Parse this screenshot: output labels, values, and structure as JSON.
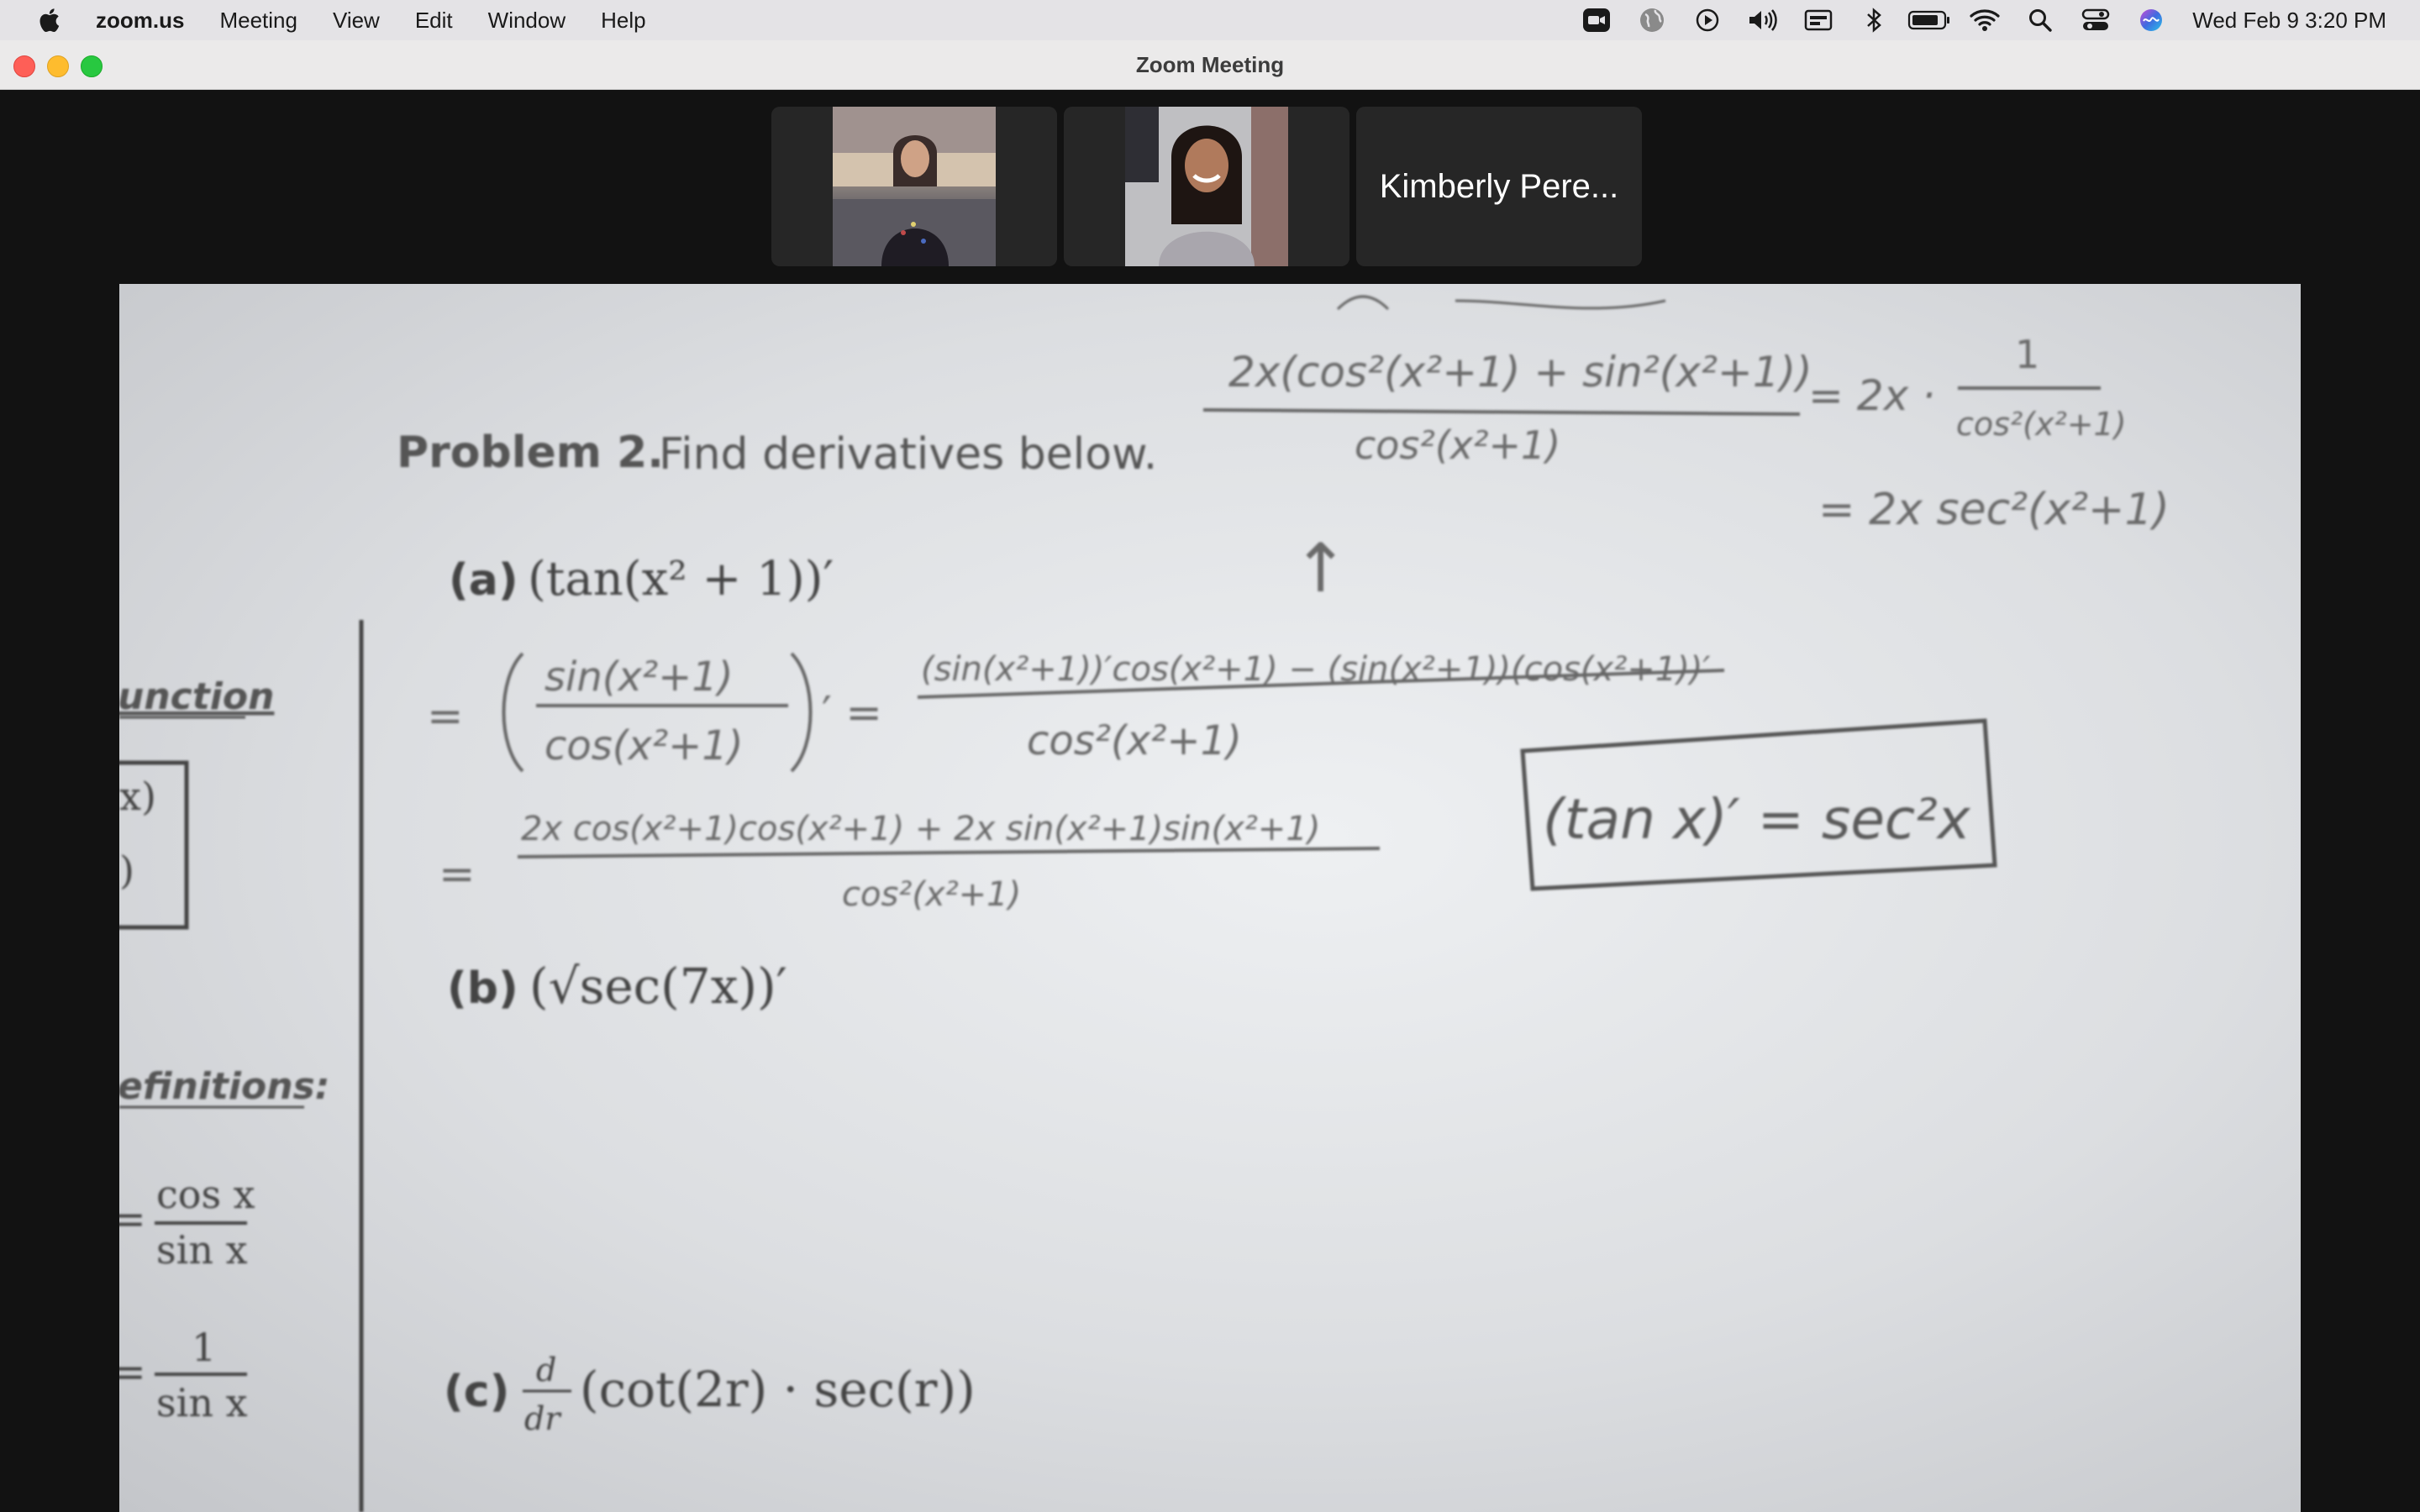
{
  "menubar": {
    "app_name": "zoom.us",
    "items": [
      "Meeting",
      "View",
      "Edit",
      "Window",
      "Help"
    ],
    "clock": "Wed Feb 9  3:20 PM",
    "status_icons": [
      "zoom-icon",
      "globe-icon",
      "play-icon",
      "volume-icon",
      "media-icon",
      "bluetooth-icon",
      "battery-icon",
      "wifi-icon",
      "spotlight-icon",
      "control-center-icon",
      "siri-icon"
    ]
  },
  "window": {
    "title": "Zoom Meeting"
  },
  "participants": [
    {
      "name": "",
      "has_video": true
    },
    {
      "name": "",
      "has_video": true
    },
    {
      "name": "Kimberly Pere...",
      "has_video": false
    }
  ],
  "shared_screen": {
    "printed": {
      "problem_heading": "Problem 2.",
      "problem_text": "Find derivatives below.",
      "part_a_label": "(a)",
      "part_a_expr": "(tan(x² + 1))′",
      "part_b_label": "(b)",
      "part_b_expr": "(√sec(7x))′",
      "part_c_label": "(c)",
      "part_c_d": "d",
      "part_c_dr": "dr",
      "part_c_expr": "(cot(2r) · sec(r))",
      "sidebar_function": "unction",
      "sidebar_definitions": "efinitions:",
      "sidebar_x": "x)",
      "sidebar_paren": ")",
      "sidebar_cos": "cos x",
      "sidebar_sin1": "sin x",
      "sidebar_one": "1",
      "sidebar_sin2": "sin x",
      "eq1": "=",
      "eq2": "="
    },
    "handwritten": {
      "top_numer": "2x(cos²(x²+1) + sin²(x²+1))",
      "top_denom": "cos²(x²+1)",
      "top_rhs": "= 2x ·",
      "top_rhs_numer": "1",
      "top_rhs_denom": "cos²(x²+1)",
      "line2": "= 2x sec²(x²+1)",
      "arrow": "↑",
      "step1_eq": "=",
      "step1_frac_numer": "sin(x²+1)",
      "step1_frac_denom": "cos(x²+1)",
      "step1_prime": "′ =",
      "step1_numer": "(sin(x²+1))′cos(x²+1) − (sin(x²+1))(cos(x²+1))′",
      "step1_denom": "cos²(x²+1)",
      "step2_eq": "=",
      "step2_numer": "2x cos(x²+1)cos(x²+1) + 2x sin(x²+1)sin(x²+1)",
      "step2_denom": "cos²(x²+1)",
      "boxed": "(tan x)′ = sec²x"
    }
  }
}
